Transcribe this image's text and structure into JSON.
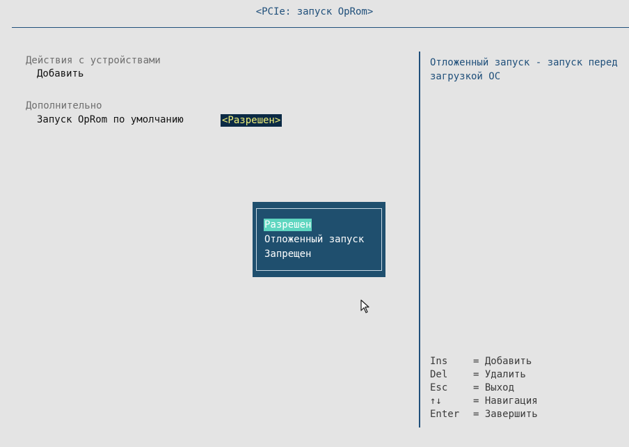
{
  "header": {
    "title": "<PCIe: запуск OpRom>"
  },
  "main": {
    "section_devices": "Действия с устройствами",
    "add_item": "Добавить",
    "section_additional": "Дополнительно",
    "opt_label": "Запуск OpRom по умолчанию",
    "opt_value": "<Разрешен>"
  },
  "help": {
    "text": "Отложенный запуск - запуск перед загрузкой ОС"
  },
  "popup": {
    "options": [
      "Разрешен",
      "Отложенный запуск",
      "Запрещен"
    ],
    "selected_index": 0
  },
  "keys": [
    {
      "key": "Ins",
      "action": "= Добавить"
    },
    {
      "key": "Del",
      "action": "= Удалить"
    },
    {
      "key": "Esc",
      "action": "= Выход"
    },
    {
      "key": "↑↓",
      "action": "= Навигация"
    },
    {
      "key": "Enter",
      "action": "= Завершить"
    }
  ],
  "colors": {
    "background": "#e4e4e4",
    "accent": "#1f4f7a",
    "popup_bg": "#1f4f6e",
    "highlight": "#5fd6c0",
    "value_text": "#f2f27a"
  },
  "icons": {
    "cursor": "mouse-pointer-icon"
  }
}
